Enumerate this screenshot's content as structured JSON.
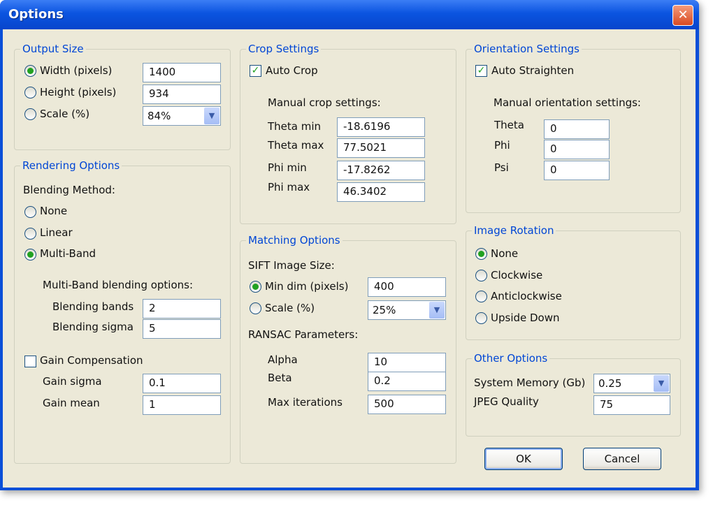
{
  "window": {
    "title": "Options",
    "close_glyph": "✕"
  },
  "output_size": {
    "legend": "Output Size",
    "width_label": "Width (pixels)",
    "width_value": "1400",
    "height_label": "Height (pixels)",
    "height_value": "934",
    "scale_label": "Scale (%)",
    "scale_value": "84%",
    "selected": "width"
  },
  "rendering": {
    "legend": "Rendering Options",
    "blending_method_label": "Blending Method:",
    "none_label": "None",
    "linear_label": "Linear",
    "multiband_label": "Multi-Band",
    "selected": "multi-band",
    "multiband_options_label": "Multi-Band blending options:",
    "bands_label": "Blending bands",
    "bands_value": "2",
    "sigma_label": "Blending sigma",
    "sigma_value": "5",
    "gain_comp_label": "Gain Compensation",
    "gain_comp_checked": false,
    "gain_sigma_label": "Gain sigma",
    "gain_sigma_value": "0.1",
    "gain_mean_label": "Gain mean",
    "gain_mean_value": "1"
  },
  "crop": {
    "legend": "Crop Settings",
    "auto_crop_label": "Auto Crop",
    "auto_crop_checked": true,
    "manual_label": "Manual crop settings:",
    "theta_min_label": "Theta min",
    "theta_min_value": "-18.6196",
    "theta_max_label": "Theta max",
    "theta_max_value": "77.5021",
    "phi_min_label": "Phi min",
    "phi_min_value": "-17.8262",
    "phi_max_label": "Phi max",
    "phi_max_value": "46.3402"
  },
  "matching": {
    "legend": "Matching Options",
    "sift_label": "SIFT Image Size:",
    "min_dim_label": "Min dim (pixels)",
    "min_dim_value": "400",
    "scale_label": "Scale (%)",
    "scale_value": "25%",
    "selected": "min-dim",
    "ransac_label": "RANSAC Parameters:",
    "alpha_label": "Alpha",
    "alpha_value": "10",
    "beta_label": "Beta",
    "beta_value": "0.2",
    "max_iter_label": "Max iterations",
    "max_iter_value": "500"
  },
  "orientation": {
    "legend": "Orientation Settings",
    "auto_label": "Auto Straighten",
    "auto_checked": true,
    "manual_label": "Manual orientation settings:",
    "theta_label": "Theta",
    "theta_value": "0",
    "phi_label": "Phi",
    "phi_value": "0",
    "psi_label": "Psi",
    "psi_value": "0"
  },
  "rotation": {
    "legend": "Image Rotation",
    "none_label": "None",
    "cw_label": "Clockwise",
    "acw_label": "Anticlockwise",
    "upside_label": "Upside Down",
    "selected": "none"
  },
  "other": {
    "legend": "Other Options",
    "memory_label": "System Memory (Gb)",
    "memory_value": "0.25",
    "jpeg_label": "JPEG Quality",
    "jpeg_value": "75"
  },
  "buttons": {
    "ok": "OK",
    "cancel": "Cancel"
  },
  "icons": {
    "dropdown": "▼",
    "check": "✓"
  },
  "colors": {
    "titlebar": "#0b54e0",
    "legend": "#0046d5",
    "dialog_bg": "#ece9d8",
    "radio_dot": "#21a121"
  }
}
